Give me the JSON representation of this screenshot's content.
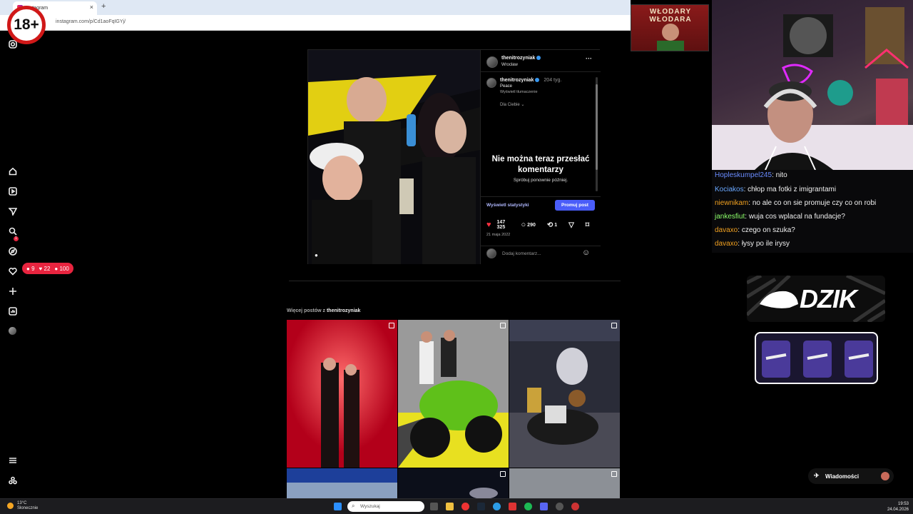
{
  "browser": {
    "tab_title": "Instagram",
    "tab_close": "×",
    "new_tab": "+",
    "url": "instagram.com/p/Cd1aoFqIGYj/"
  },
  "age_badge": "18+",
  "sidebar": {
    "notif_badge": "1",
    "activity_counts": {
      "comments": "9",
      "likes": "22",
      "followers": "100"
    }
  },
  "post": {
    "author": "thenitrozyniak",
    "location": "Wrocław",
    "caption_author": "thenitrozyniak",
    "caption_age": "204 tyg.",
    "caption_text": "Peace",
    "translate": "Wyświetl tłumaczenie",
    "for_you": "Dla Ciebie",
    "error_title": "Nie można teraz przesłać komentarzy",
    "error_sub": "Spróbuj ponownie później.",
    "stats_link": "Wyświetl statystyki",
    "promote": "Promuj post",
    "likes": "147 325",
    "comments": "290",
    "reposts": "1",
    "date": "21 maja 2022",
    "comment_placeholder": "Dodaj komentarz...",
    "more_menu": "···"
  },
  "more_posts": {
    "label": "Więcej postów z",
    "user": "thenitrozyniak"
  },
  "overlay": {
    "banner_text": "WŁODARY WŁODARA",
    "chat": [
      {
        "user": "Hopleskumpel245",
        "text": "nito",
        "color": "#6a8cff"
      },
      {
        "user": "Kociakos",
        "text": "chłop ma fotki z imigrantami",
        "color": "#6aa8ff"
      },
      {
        "user": "niewnikam",
        "text": "no ale co on sie promuje czy co on robi",
        "color": "#f0a020"
      },
      {
        "user": "jankesfiut",
        "text": "wuja cos wplacal na fundacje?",
        "color": "#8cff6a"
      },
      {
        "user": "davaxo",
        "text": "czego on szuka?",
        "color": "#f0a020"
      },
      {
        "user": "davaxo",
        "text": "łysy po ile irysy",
        "color": "#f0a020"
      }
    ],
    "dzik": "DZIK",
    "messages": "Wiadomości"
  },
  "taskbar": {
    "temp": "13°C",
    "weather": "Słonecznie",
    "search_placeholder": "Wyszukaj",
    "time": "19:53",
    "date": "24.04.2026"
  }
}
